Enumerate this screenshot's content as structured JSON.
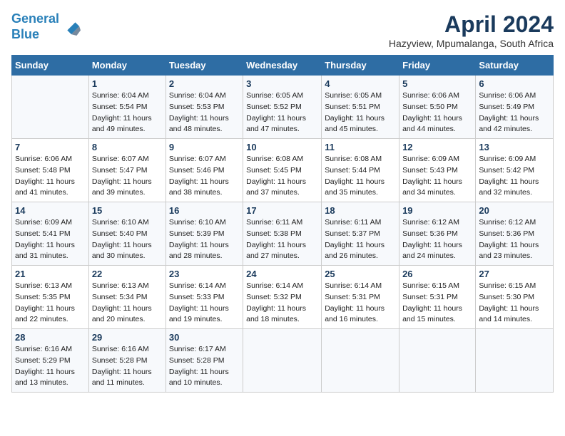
{
  "logo": {
    "line1": "General",
    "line2": "Blue"
  },
  "title": "April 2024",
  "subtitle": "Hazyview, Mpumalanga, South Africa",
  "days_of_week": [
    "Sunday",
    "Monday",
    "Tuesday",
    "Wednesday",
    "Thursday",
    "Friday",
    "Saturday"
  ],
  "weeks": [
    [
      {
        "day": "",
        "sunrise": "",
        "sunset": "",
        "daylight": ""
      },
      {
        "day": "1",
        "sunrise": "Sunrise: 6:04 AM",
        "sunset": "Sunset: 5:54 PM",
        "daylight": "Daylight: 11 hours and 49 minutes."
      },
      {
        "day": "2",
        "sunrise": "Sunrise: 6:04 AM",
        "sunset": "Sunset: 5:53 PM",
        "daylight": "Daylight: 11 hours and 48 minutes."
      },
      {
        "day": "3",
        "sunrise": "Sunrise: 6:05 AM",
        "sunset": "Sunset: 5:52 PM",
        "daylight": "Daylight: 11 hours and 47 minutes."
      },
      {
        "day": "4",
        "sunrise": "Sunrise: 6:05 AM",
        "sunset": "Sunset: 5:51 PM",
        "daylight": "Daylight: 11 hours and 45 minutes."
      },
      {
        "day": "5",
        "sunrise": "Sunrise: 6:06 AM",
        "sunset": "Sunset: 5:50 PM",
        "daylight": "Daylight: 11 hours and 44 minutes."
      },
      {
        "day": "6",
        "sunrise": "Sunrise: 6:06 AM",
        "sunset": "Sunset: 5:49 PM",
        "daylight": "Daylight: 11 hours and 42 minutes."
      }
    ],
    [
      {
        "day": "7",
        "sunrise": "Sunrise: 6:06 AM",
        "sunset": "Sunset: 5:48 PM",
        "daylight": "Daylight: 11 hours and 41 minutes."
      },
      {
        "day": "8",
        "sunrise": "Sunrise: 6:07 AM",
        "sunset": "Sunset: 5:47 PM",
        "daylight": "Daylight: 11 hours and 39 minutes."
      },
      {
        "day": "9",
        "sunrise": "Sunrise: 6:07 AM",
        "sunset": "Sunset: 5:46 PM",
        "daylight": "Daylight: 11 hours and 38 minutes."
      },
      {
        "day": "10",
        "sunrise": "Sunrise: 6:08 AM",
        "sunset": "Sunset: 5:45 PM",
        "daylight": "Daylight: 11 hours and 37 minutes."
      },
      {
        "day": "11",
        "sunrise": "Sunrise: 6:08 AM",
        "sunset": "Sunset: 5:44 PM",
        "daylight": "Daylight: 11 hours and 35 minutes."
      },
      {
        "day": "12",
        "sunrise": "Sunrise: 6:09 AM",
        "sunset": "Sunset: 5:43 PM",
        "daylight": "Daylight: 11 hours and 34 minutes."
      },
      {
        "day": "13",
        "sunrise": "Sunrise: 6:09 AM",
        "sunset": "Sunset: 5:42 PM",
        "daylight": "Daylight: 11 hours and 32 minutes."
      }
    ],
    [
      {
        "day": "14",
        "sunrise": "Sunrise: 6:09 AM",
        "sunset": "Sunset: 5:41 PM",
        "daylight": "Daylight: 11 hours and 31 minutes."
      },
      {
        "day": "15",
        "sunrise": "Sunrise: 6:10 AM",
        "sunset": "Sunset: 5:40 PM",
        "daylight": "Daylight: 11 hours and 30 minutes."
      },
      {
        "day": "16",
        "sunrise": "Sunrise: 6:10 AM",
        "sunset": "Sunset: 5:39 PM",
        "daylight": "Daylight: 11 hours and 28 minutes."
      },
      {
        "day": "17",
        "sunrise": "Sunrise: 6:11 AM",
        "sunset": "Sunset: 5:38 PM",
        "daylight": "Daylight: 11 hours and 27 minutes."
      },
      {
        "day": "18",
        "sunrise": "Sunrise: 6:11 AM",
        "sunset": "Sunset: 5:37 PM",
        "daylight": "Daylight: 11 hours and 26 minutes."
      },
      {
        "day": "19",
        "sunrise": "Sunrise: 6:12 AM",
        "sunset": "Sunset: 5:36 PM",
        "daylight": "Daylight: 11 hours and 24 minutes."
      },
      {
        "day": "20",
        "sunrise": "Sunrise: 6:12 AM",
        "sunset": "Sunset: 5:36 PM",
        "daylight": "Daylight: 11 hours and 23 minutes."
      }
    ],
    [
      {
        "day": "21",
        "sunrise": "Sunrise: 6:13 AM",
        "sunset": "Sunset: 5:35 PM",
        "daylight": "Daylight: 11 hours and 22 minutes."
      },
      {
        "day": "22",
        "sunrise": "Sunrise: 6:13 AM",
        "sunset": "Sunset: 5:34 PM",
        "daylight": "Daylight: 11 hours and 20 minutes."
      },
      {
        "day": "23",
        "sunrise": "Sunrise: 6:14 AM",
        "sunset": "Sunset: 5:33 PM",
        "daylight": "Daylight: 11 hours and 19 minutes."
      },
      {
        "day": "24",
        "sunrise": "Sunrise: 6:14 AM",
        "sunset": "Sunset: 5:32 PM",
        "daylight": "Daylight: 11 hours and 18 minutes."
      },
      {
        "day": "25",
        "sunrise": "Sunrise: 6:14 AM",
        "sunset": "Sunset: 5:31 PM",
        "daylight": "Daylight: 11 hours and 16 minutes."
      },
      {
        "day": "26",
        "sunrise": "Sunrise: 6:15 AM",
        "sunset": "Sunset: 5:31 PM",
        "daylight": "Daylight: 11 hours and 15 minutes."
      },
      {
        "day": "27",
        "sunrise": "Sunrise: 6:15 AM",
        "sunset": "Sunset: 5:30 PM",
        "daylight": "Daylight: 11 hours and 14 minutes."
      }
    ],
    [
      {
        "day": "28",
        "sunrise": "Sunrise: 6:16 AM",
        "sunset": "Sunset: 5:29 PM",
        "daylight": "Daylight: 11 hours and 13 minutes."
      },
      {
        "day": "29",
        "sunrise": "Sunrise: 6:16 AM",
        "sunset": "Sunset: 5:28 PM",
        "daylight": "Daylight: 11 hours and 11 minutes."
      },
      {
        "day": "30",
        "sunrise": "Sunrise: 6:17 AM",
        "sunset": "Sunset: 5:28 PM",
        "daylight": "Daylight: 11 hours and 10 minutes."
      },
      {
        "day": "",
        "sunrise": "",
        "sunset": "",
        "daylight": ""
      },
      {
        "day": "",
        "sunrise": "",
        "sunset": "",
        "daylight": ""
      },
      {
        "day": "",
        "sunrise": "",
        "sunset": "",
        "daylight": ""
      },
      {
        "day": "",
        "sunrise": "",
        "sunset": "",
        "daylight": ""
      }
    ]
  ]
}
